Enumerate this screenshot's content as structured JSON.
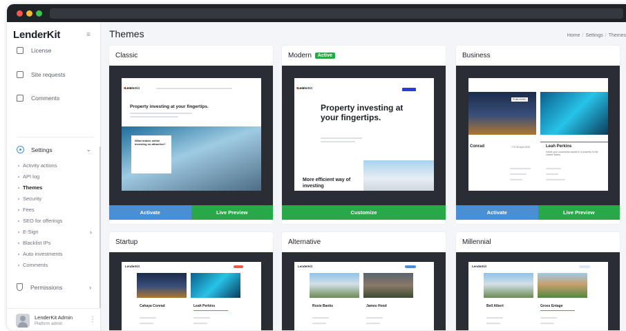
{
  "app": {
    "logo": "LenderKit",
    "collapse_icon": "sidebar-collapse-icon"
  },
  "sidebar": {
    "top_items": [
      {
        "label": "License",
        "icon": "document-icon"
      },
      {
        "label": "Site requests",
        "icon": "mail-icon"
      },
      {
        "label": "Comments",
        "icon": "chat-icon"
      }
    ],
    "settings": {
      "label": "Settings",
      "icon": "gear-icon",
      "expanded": true,
      "items": [
        {
          "label": "Activity actions"
        },
        {
          "label": "API log"
        },
        {
          "label": "Themes",
          "active": true
        },
        {
          "label": "Security"
        },
        {
          "label": "Fees"
        },
        {
          "label": "SEO for offerings"
        },
        {
          "label": "E-Sign",
          "has_children": true
        },
        {
          "label": "Blacklist IPs"
        },
        {
          "label": "Auto investments"
        },
        {
          "label": "Comments"
        }
      ]
    },
    "permissions": {
      "label": "Permissions",
      "icon": "shield-icon"
    },
    "user": {
      "name": "LenderKit Admin",
      "role": "Platform admin"
    }
  },
  "header": {
    "title": "Themes",
    "breadcrumb": [
      "Home",
      "Settings",
      "Themes"
    ]
  },
  "themes": [
    {
      "name": "Classic",
      "active": false,
      "buttons": [
        "Activate",
        "Live Preview"
      ],
      "preview": {
        "logo": "LenderKit",
        "headline": "Property investing at your fingertips.",
        "card_title": "What makes online investing so attractive?"
      }
    },
    {
      "name": "Modern",
      "active": true,
      "badge": "Active",
      "buttons": [
        "Customize"
      ],
      "preview": {
        "logo": "LenderKit",
        "headline": "Property investing at your fingertips.",
        "subheadline": "More efficient way of investing"
      }
    },
    {
      "name": "Business",
      "active": false,
      "buttons": [
        "Activate",
        "Live Preview"
      ],
      "preview": {
        "badge": "PUBLISHED",
        "item1_name": "Conrad",
        "item1_date": "770 28 April 2022",
        "item2_name": "Leah Perkins",
        "item2_desc": "Invest your successful capital in a property in the United States"
      }
    },
    {
      "name": "Startup",
      "preview": {
        "logo": "LenderKit",
        "item1_name": "Cahaya Conrad",
        "item2_name": "Leah Perkins"
      }
    },
    {
      "name": "Alternative",
      "preview": {
        "logo": "LenderKit",
        "item1_name": "Rosie Banks",
        "item2_name": "James Hood"
      }
    },
    {
      "name": "Millennial",
      "preview": {
        "logo": "LenderKit",
        "item1_name": "Bell Albert",
        "item2_name": "Gross Entage"
      }
    }
  ],
  "colors": {
    "accent_blue": "#4a8fd4",
    "accent_green": "#29a84a",
    "preview_bg": "#2a2d33",
    "titlebar": "#1f2227"
  }
}
